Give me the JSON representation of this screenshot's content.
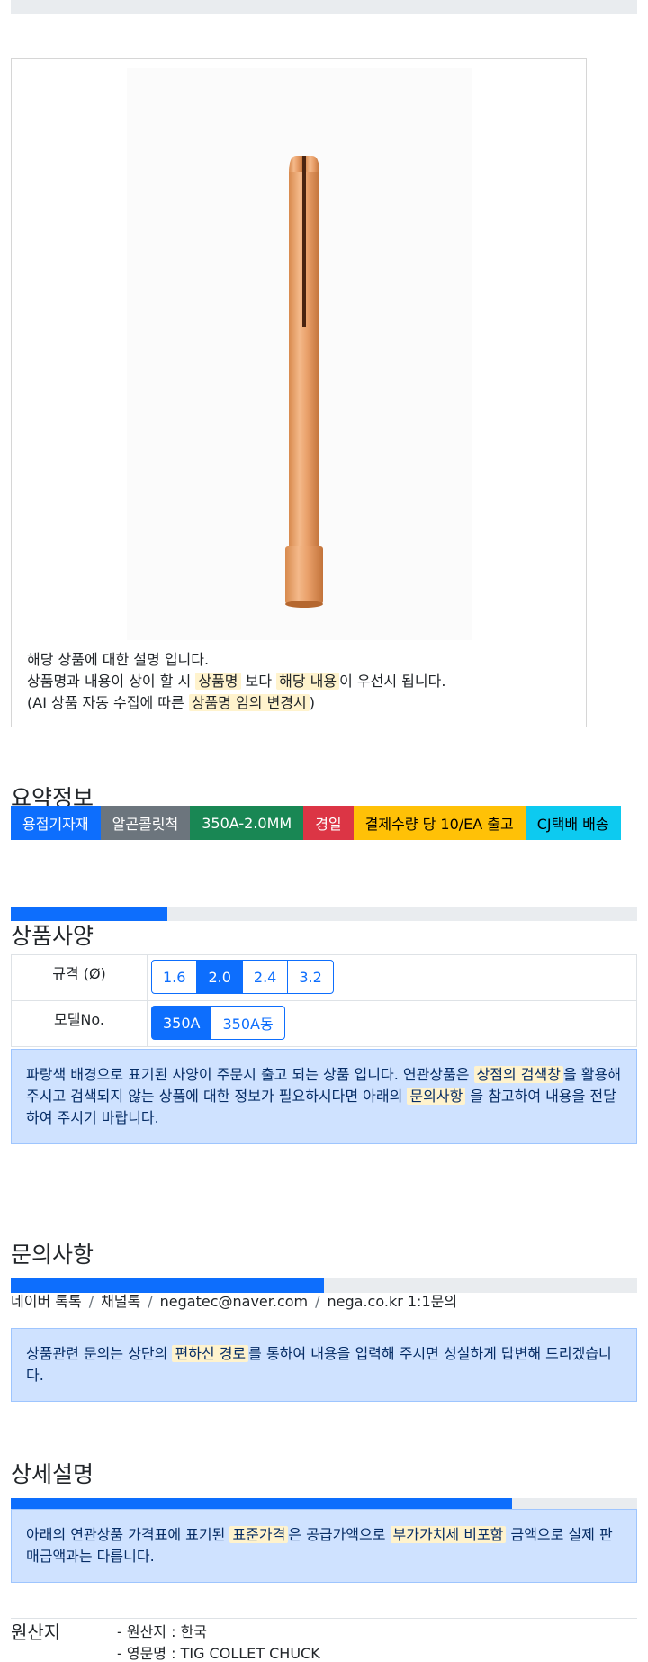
{
  "product": {
    "description_lines": [
      {
        "text": "해당 상품에 대한 설명 입니다."
      },
      {
        "pre": "상품명과 내용이 상이 할 시 ",
        "hl1": "상품명",
        "mid": " 보다 ",
        "hl2": "해당 내용",
        "post": "이 우선시 됩니다."
      },
      {
        "pre": "(AI 상품 자동 수집에 따른 ",
        "hl1": "상품명 임의 변경시",
        "post": ")"
      }
    ]
  },
  "summary": {
    "title": "요약정보",
    "badges": [
      {
        "label": "용접기자재",
        "bg": "#0d6efd",
        "fg": "#ffffff"
      },
      {
        "label": "알곤콜릿척",
        "bg": "#6c757d",
        "fg": "#ffffff"
      },
      {
        "label": "350A-2.0MM",
        "bg": "#198754",
        "fg": "#ffffff"
      },
      {
        "label": "경일",
        "bg": "#dc3545",
        "fg": "#ffffff"
      },
      {
        "label": "결제수량 당 10/EA 출고",
        "bg": "#ffc107",
        "fg": "#000000"
      },
      {
        "label": "CJ택배 배송",
        "bg": "#0dcaf0",
        "fg": "#000000"
      }
    ]
  },
  "specs": {
    "title": "상품사양",
    "progress_fraction": 0.25,
    "rows": [
      {
        "label": "규격 (Ø)",
        "options": [
          "1.6",
          "2.0",
          "2.4",
          "3.2"
        ],
        "selected": "2.0"
      },
      {
        "label": "모델No.",
        "options": [
          "350A",
          "350A동"
        ],
        "selected": "350A"
      }
    ],
    "notice": {
      "pre": "파랑색 배경으로 표기된 사양이 주문시 출고 되는 상품 입니다. 연관상품은 ",
      "hl1": "상점의 검색창",
      "mid": "을 활용해 주시고 검색되지 않는 상품에 대한 정보가 필요하시다면 아래의 ",
      "hl2": "문의사항",
      "post": " 을 참고하여 내용을 전달하여 주시기 바랍니다."
    }
  },
  "inquiry": {
    "title": "문의사항",
    "progress_fraction": 0.5,
    "channels": [
      "네이버 톡톡",
      "채널톡",
      "negatec@naver.com",
      "nega.co.kr 1:1문의"
    ],
    "notice": {
      "pre": "상품관련 문의는 상단의 ",
      "hl1": "편하신 경로",
      "post": "를 통하여 내용을 입력해 주시면 성실하게 답변해 드리겠습니다."
    }
  },
  "detail": {
    "title": "상세설명",
    "progress_fraction": 0.8,
    "notice": {
      "pre": "아래의 연관상품 가격표에 표기된 ",
      "hl1": "표준가격",
      "mid": "은 공급가액으로 ",
      "hl2": "부가가치세 비포함",
      "post": " 금액으로 실제 판매금액과는 다릅니다."
    }
  },
  "origin": {
    "label": "원산지",
    "items": [
      "- 원산지 : 한국",
      "- 영문명 : TIG COLLET CHUCK"
    ]
  }
}
